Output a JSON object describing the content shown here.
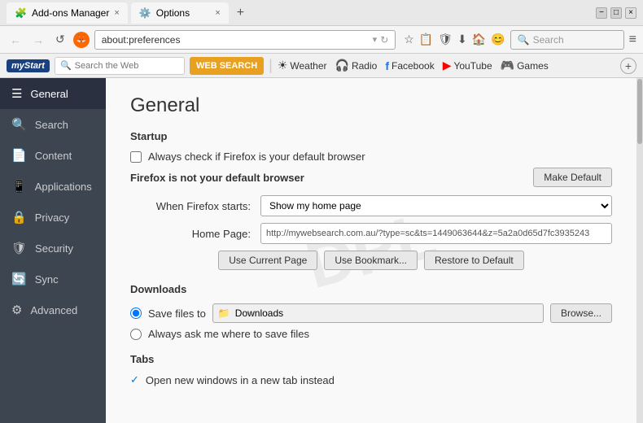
{
  "titlebar": {
    "tab1_icon": "🧩",
    "tab1_label": "Add-ons Manager",
    "tab2_icon": "⚙️",
    "tab2_label": "Options",
    "new_tab_icon": "+",
    "minimize": "−",
    "maximize": "□",
    "close": "×"
  },
  "navbar": {
    "back": "←",
    "forward": "→",
    "reload": "↺",
    "firefox_label": "fx",
    "url": "about:preferences",
    "search_placeholder": "Search",
    "star_icon": "☆",
    "bookmark_icon": "📋",
    "shield_icon": "🛡",
    "download_icon": "⬇",
    "home_icon": "🏠",
    "account_icon": "😊",
    "menu_icon": "≡"
  },
  "toolbar": {
    "mystart_label": "myStart",
    "search_placeholder": "Search the Web",
    "web_search_btn": "WEB SEARCH",
    "items": [
      {
        "icon": "☀",
        "label": "Weather"
      },
      {
        "icon": "🎧",
        "label": "Radio"
      },
      {
        "icon": "f",
        "label": "Facebook"
      },
      {
        "icon": "▶",
        "label": "YouTube"
      },
      {
        "icon": "🎮",
        "label": "Games"
      }
    ]
  },
  "sidebar": {
    "items": [
      {
        "icon": "☰",
        "label": "General",
        "active": true
      },
      {
        "icon": "🔍",
        "label": "Search"
      },
      {
        "icon": "📄",
        "label": "Content"
      },
      {
        "icon": "📱",
        "label": "Applications"
      },
      {
        "icon": "🔒",
        "label": "Privacy"
      },
      {
        "icon": "🛡",
        "label": "Security"
      },
      {
        "icon": "🔄",
        "label": "Sync"
      },
      {
        "icon": "⚙",
        "label": "Advanced"
      }
    ]
  },
  "content": {
    "page_title": "General",
    "startup": {
      "section_title": "Startup",
      "default_check": "Always check if Firefox is your default browser",
      "not_default_text": "Firefox is not your default browser",
      "make_default_btn": "Make Default",
      "when_starts_label": "When Firefox starts:",
      "starts_value": "Show my home page",
      "home_page_label": "Home Page:",
      "home_page_value": "http://mywebsearch.com.au/?type=sc&ts=1449063644&z=5a2a0d65d7fc3935243",
      "use_current_btn": "Use Current Page",
      "use_bookmark_btn": "Use Bookmark...",
      "restore_default_btn": "Restore to Default"
    },
    "downloads": {
      "section_title": "Downloads",
      "save_files_label": "Save files to",
      "folder_icon": "📁",
      "folder_name": "Downloads",
      "browse_btn": "Browse...",
      "always_ask": "Always ask me where to save files"
    },
    "tabs": {
      "section_title": "Tabs",
      "open_new_windows": "Open new windows in a new tab instead"
    }
  }
}
